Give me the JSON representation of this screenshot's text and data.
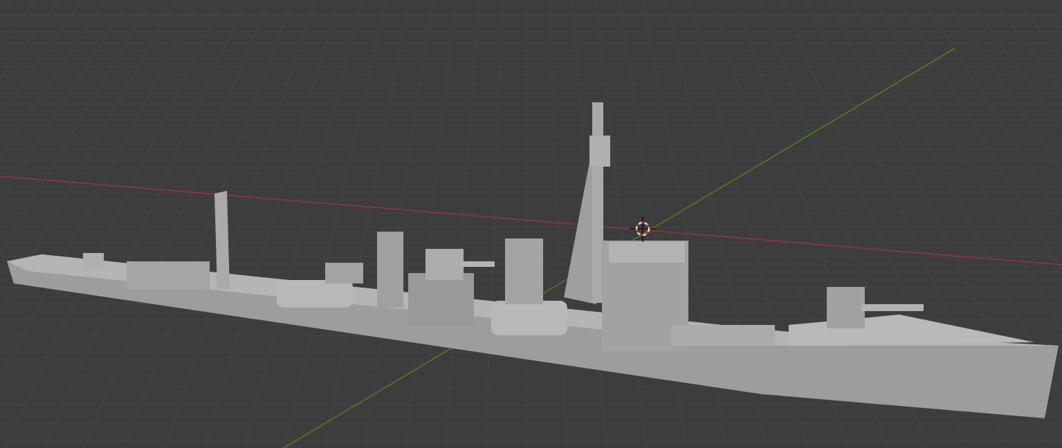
{
  "viewport": {
    "show_grid": true,
    "show_axes": true,
    "show_cursor": true
  }
}
